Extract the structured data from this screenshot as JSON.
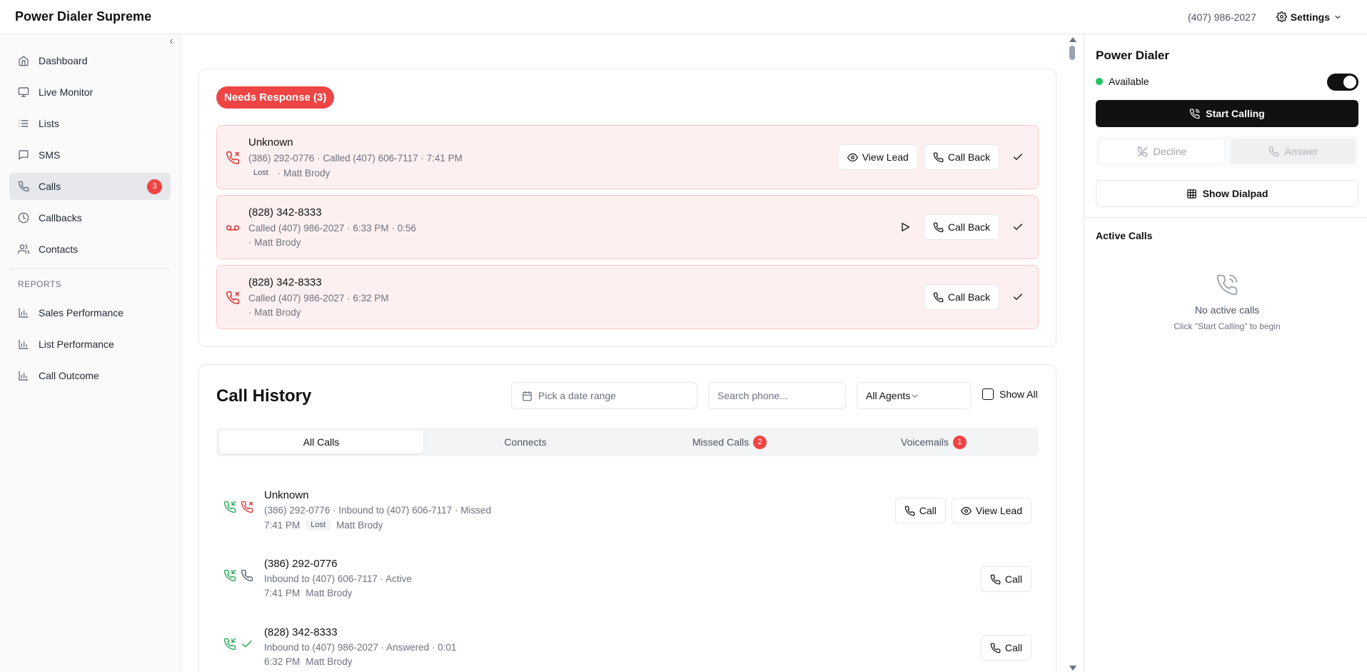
{
  "app": {
    "title": "Power Dialer Supreme",
    "phone": "(407) 986-2027",
    "settings_label": "Settings"
  },
  "sidebar": {
    "items": [
      {
        "label": "Dashboard",
        "icon": "home-icon"
      },
      {
        "label": "Live Monitor",
        "icon": "monitor-icon"
      },
      {
        "label": "Lists",
        "icon": "list-icon"
      },
      {
        "label": "SMS",
        "icon": "message-icon"
      },
      {
        "label": "Calls",
        "icon": "phone-icon",
        "badge": "3",
        "active": true
      },
      {
        "label": "Callbacks",
        "icon": "clock-icon"
      },
      {
        "label": "Contacts",
        "icon": "users-icon"
      }
    ],
    "reports_label": "REPORTS",
    "reports": [
      {
        "label": "Sales Performance",
        "icon": "bar-chart-icon"
      },
      {
        "label": "List Performance",
        "icon": "bar-chart-icon"
      },
      {
        "label": "Call Outcome",
        "icon": "bar-chart-icon"
      }
    ]
  },
  "needs_response": {
    "badge": "Needs Response (3)",
    "items": [
      {
        "name": "Unknown",
        "detail": "(386) 292-0776 · Called (407) 606-7117 · 7:41 PM",
        "tag": "Lost",
        "agent": "· Matt Brody",
        "view_label": "View Lead",
        "callback_label": "Call Back"
      },
      {
        "name": "(828) 342-8333",
        "detail": "Called (407) 986-2027 · 6:33 PM · 0:56",
        "agent": "· Matt Brody",
        "callback_label": "Call Back"
      },
      {
        "name": "(828) 342-8333",
        "detail": "Called (407) 986-2027 · 6:32 PM",
        "agent": "· Matt Brody",
        "callback_label": "Call Back"
      }
    ]
  },
  "history": {
    "title": "Call History",
    "date_placeholder": "Pick a date range",
    "search_placeholder": "Search phone...",
    "agent_select": "All Agents",
    "show_all_label": "Show All",
    "tabs": [
      {
        "label": "All Calls",
        "active": true
      },
      {
        "label": "Connects"
      },
      {
        "label": "Missed Calls",
        "badge": "2"
      },
      {
        "label": "Voicemails",
        "badge": "1"
      }
    ],
    "rows": [
      {
        "name": "Unknown",
        "detail": "(386) 292-0776 · Inbound to (407) 606-7117 · Missed",
        "time": "7:41 PM",
        "tag": "Lost",
        "agent": "Matt Brody",
        "call_label": "Call",
        "view_label": "View Lead"
      },
      {
        "name": "(386) 292-0776",
        "detail": "Inbound to (407) 606-7117 · Active",
        "time": "7:41 PM",
        "agent": "Matt Brody",
        "call_label": "Call"
      },
      {
        "name": "(828) 342-8333",
        "detail": "Inbound to (407) 986-2027 · Answered · 0:01",
        "time": "6:32 PM",
        "agent": "Matt Brody",
        "call_label": "Call"
      }
    ]
  },
  "dialer": {
    "title": "Power Dialer",
    "status": "Available",
    "start_label": "Start Calling",
    "decline_label": "Decline",
    "answer_label": "Answer",
    "dialpad_label": "Show Dialpad",
    "active_title": "Active Calls",
    "empty_title": "No active calls",
    "empty_sub": "Click \"Start Calling\" to begin"
  },
  "colors": {
    "accent": "#111111",
    "danger": "#ef4444",
    "success": "#22c55e",
    "alert_bg": "#fef0f0"
  }
}
